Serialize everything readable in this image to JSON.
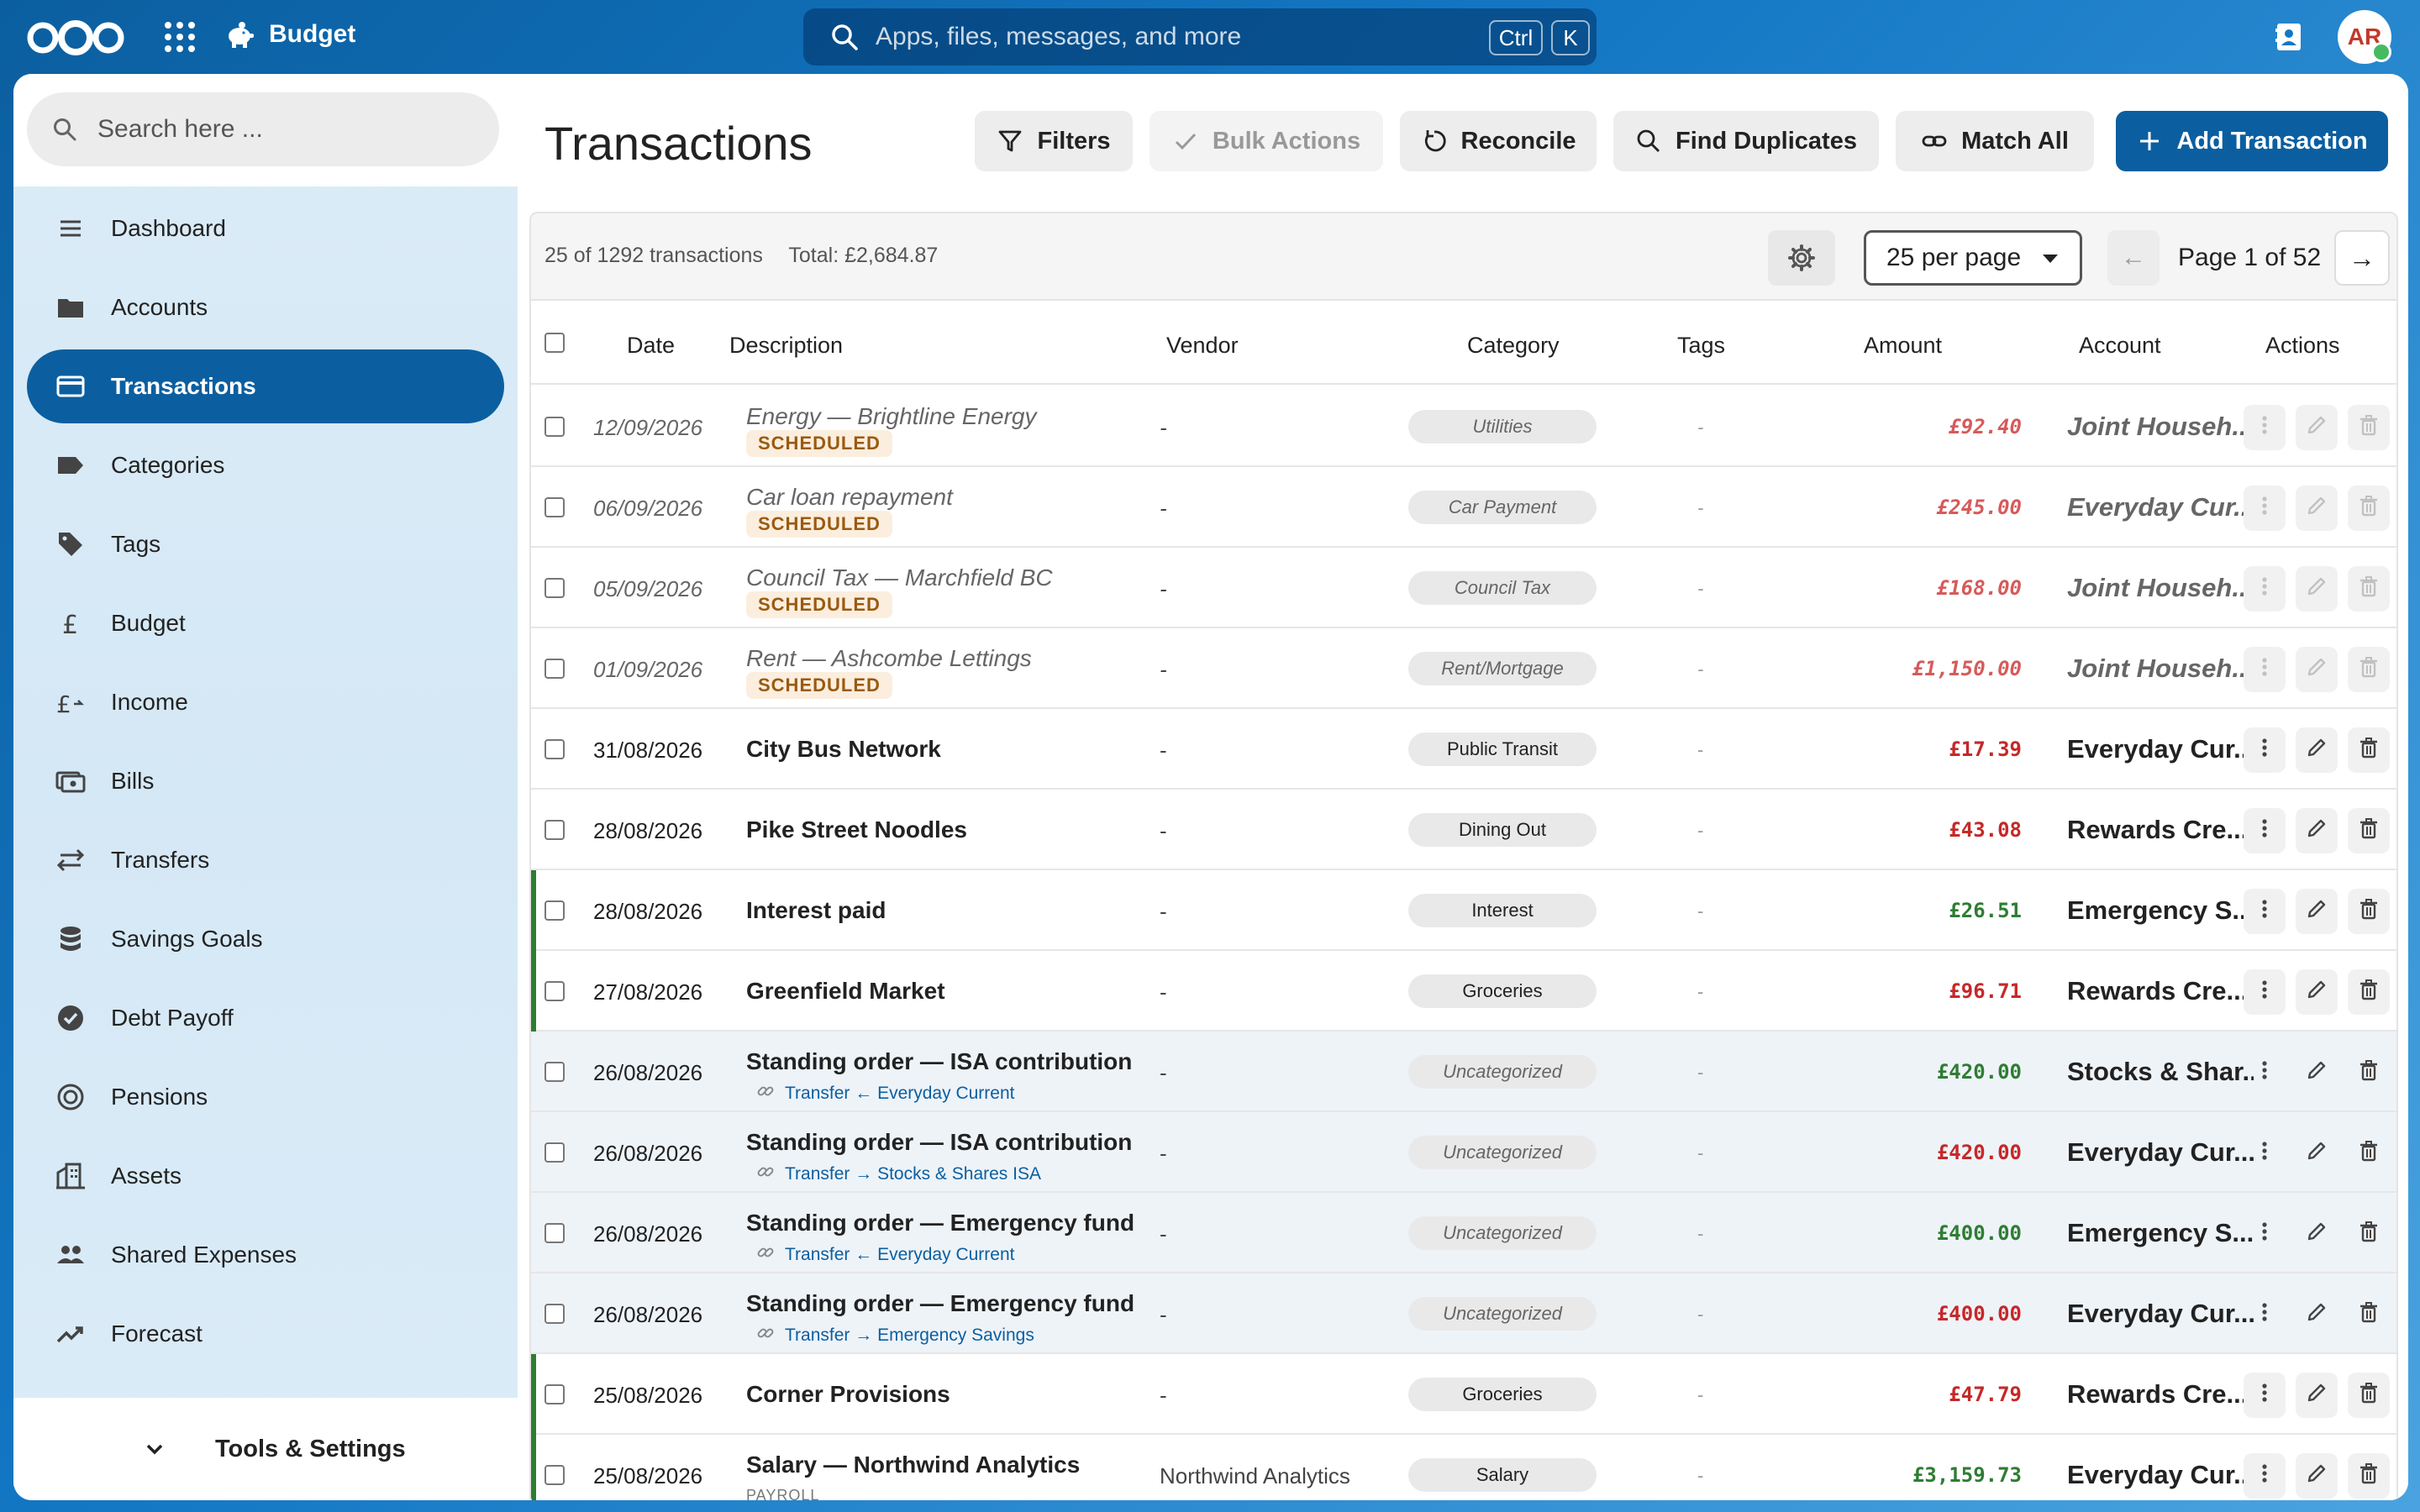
{
  "header": {
    "app_name": "Budget",
    "search_placeholder": "Apps, files, messages, and more",
    "shortcut_ctrl": "Ctrl",
    "shortcut_k": "K",
    "avatar_initials": "AR"
  },
  "sidebar": {
    "search_placeholder": "Search here ...",
    "items": [
      {
        "label": "Dashboard",
        "icon": "menu-lines-icon"
      },
      {
        "label": "Accounts",
        "icon": "folder-icon"
      },
      {
        "label": "Transactions",
        "icon": "credit-card-icon",
        "active": true
      },
      {
        "label": "Categories",
        "icon": "label-icon"
      },
      {
        "label": "Tags",
        "icon": "tag-icon"
      },
      {
        "label": "Budget",
        "icon": "pound-icon"
      },
      {
        "label": "Income",
        "icon": "pound-plus-icon"
      },
      {
        "label": "Bills",
        "icon": "bills-icon"
      },
      {
        "label": "Transfers",
        "icon": "swap-icon"
      },
      {
        "label": "Savings Goals",
        "icon": "database-icon"
      },
      {
        "label": "Debt Payoff",
        "icon": "check-circle-icon"
      },
      {
        "label": "Pensions",
        "icon": "target-icon"
      },
      {
        "label": "Assets",
        "icon": "building-icon"
      },
      {
        "label": "Shared Expenses",
        "icon": "people-icon"
      },
      {
        "label": "Forecast",
        "icon": "trend-icon"
      }
    ],
    "footer_label": "Tools & Settings"
  },
  "main": {
    "title": "Transactions",
    "toolbar": {
      "filters": "Filters",
      "bulk_actions": "Bulk Actions",
      "reconcile": "Reconcile",
      "find_duplicates": "Find Duplicates",
      "match_all": "Match All",
      "add_transaction": "Add Transaction"
    },
    "summary": {
      "count_text": "25 of 1292 transactions",
      "total_text": "Total: £2,684.87",
      "per_page": "25 per page",
      "prev_arrow": "←",
      "page_text": "Page 1 of 52",
      "next_arrow": "→"
    },
    "columns": {
      "date": "Date",
      "description": "Description",
      "vendor": "Vendor",
      "category": "Category",
      "tags": "Tags",
      "amount": "Amount",
      "account": "Account",
      "actions": "Actions"
    },
    "scheduled_label": "SCHEDULED",
    "rows": [
      {
        "date": "12/09/2026",
        "description": "Energy — Brightline Energy",
        "vendor": "-",
        "category": "Utilities",
        "tags": "-",
        "amount": "£92.40",
        "account": "Joint Househ...",
        "sign": "neg",
        "kind": "sched"
      },
      {
        "date": "06/09/2026",
        "description": "Car loan repayment",
        "vendor": "-",
        "category": "Car Payment",
        "tags": "-",
        "amount": "£245.00",
        "account": "Everyday Cur...",
        "sign": "neg",
        "kind": "sched"
      },
      {
        "date": "05/09/2026",
        "description": "Council Tax — Marchfield BC",
        "vendor": "-",
        "category": "Council Tax",
        "tags": "-",
        "amount": "£168.00",
        "account": "Joint Househ...",
        "sign": "neg",
        "kind": "sched"
      },
      {
        "date": "01/09/2026",
        "description": "Rent — Ashcombe Lettings",
        "vendor": "-",
        "category": "Rent/Mortgage",
        "tags": "-",
        "amount": "£1,150.00",
        "account": "Joint Househ...",
        "sign": "neg",
        "kind": "sched"
      },
      {
        "date": "31/08/2026",
        "description": "City Bus Network",
        "vendor": "-",
        "category": "Public Transit",
        "tags": "-",
        "amount": "£17.39",
        "account": "Everyday Cur...",
        "sign": "neg",
        "kind": "normal"
      },
      {
        "date": "28/08/2026",
        "description": "Pike Street Noodles",
        "vendor": "-",
        "category": "Dining Out",
        "tags": "-",
        "amount": "£43.08",
        "account": "Rewards Cre...",
        "sign": "neg",
        "kind": "normal"
      },
      {
        "date": "28/08/2026",
        "description": "Interest paid",
        "vendor": "-",
        "category": "Interest",
        "tags": "-",
        "amount": "£26.51",
        "account": "Emergency S...",
        "sign": "pos",
        "kind": "income"
      },
      {
        "date": "27/08/2026",
        "description": "Greenfield Market",
        "vendor": "-",
        "category": "Groceries",
        "tags": "-",
        "amount": "£96.71",
        "account": "Rewards Cre...",
        "sign": "neg",
        "kind": "income-mark-neg"
      },
      {
        "date": "26/08/2026",
        "description": "Standing order — ISA contribution",
        "link": "Transfer ← Everyday Current",
        "vendor": "-",
        "category": "Uncategorized",
        "tags": "-",
        "amount": "£420.00",
        "account": "Stocks & Shar...",
        "sign": "pos",
        "kind": "transfer"
      },
      {
        "date": "26/08/2026",
        "description": "Standing order — ISA contribution",
        "link": "Transfer → Stocks & Shares ISA",
        "vendor": "-",
        "category": "Uncategorized",
        "tags": "-",
        "amount": "£420.00",
        "account": "Everyday Cur...",
        "sign": "neg",
        "kind": "transfer"
      },
      {
        "date": "26/08/2026",
        "description": "Standing order — Emergency fund",
        "link": "Transfer ← Everyday Current",
        "vendor": "-",
        "category": "Uncategorized",
        "tags": "-",
        "amount": "£400.00",
        "account": "Emergency S...",
        "sign": "pos",
        "kind": "transfer"
      },
      {
        "date": "26/08/2026",
        "description": "Standing order — Emergency fund",
        "link": "Transfer → Emergency Savings",
        "vendor": "-",
        "category": "Uncategorized",
        "tags": "-",
        "amount": "£400.00",
        "account": "Everyday Cur...",
        "sign": "neg",
        "kind": "transfer"
      },
      {
        "date": "25/08/2026",
        "description": "Corner Provisions",
        "vendor": "-",
        "category": "Groceries",
        "tags": "-",
        "amount": "£47.79",
        "account": "Rewards Cre...",
        "sign": "neg",
        "kind": "income-mark-neg"
      },
      {
        "date": "25/08/2026",
        "description": "Salary — Northwind Analytics",
        "sub": "PAYROLL",
        "vendor": "Northwind Analytics",
        "category": "Salary",
        "tags": "-",
        "amount": "£3,159.73",
        "account": "Everyday Cur...",
        "sign": "pos",
        "kind": "income"
      }
    ]
  }
}
